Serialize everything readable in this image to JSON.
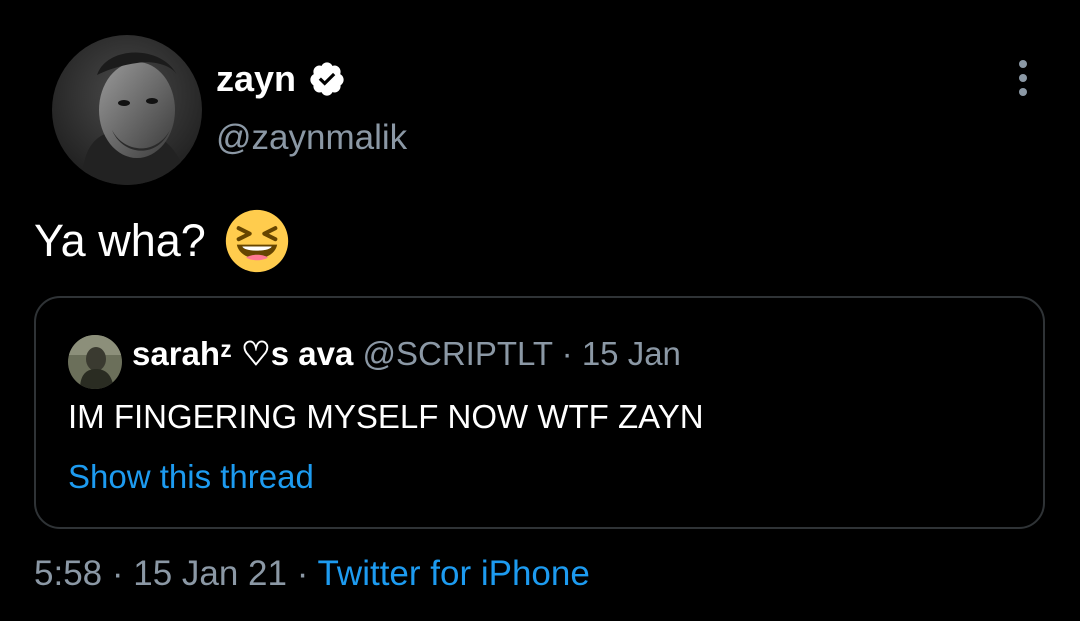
{
  "author": {
    "display_name": "zayn",
    "handle": "@zaynmalik",
    "verified_icon": "verified-badge-icon",
    "avatar_icon": "profile-photo"
  },
  "more_icon": "more-options-icon",
  "tweet": {
    "text": "Ya wha?",
    "emoji_icon": "laughing-emoji-icon"
  },
  "quoted_tweet": {
    "display_name": "sarahᶻ ♡s ava",
    "handle": "@SCRIPTLT",
    "separator": "·",
    "date": "15 Jan",
    "text": "IM FINGERING MYSELF NOW WTF ZAYN",
    "show_thread": "Show this thread"
  },
  "footer": {
    "time": "5:58",
    "sep1": "·",
    "date": "15 Jan 21",
    "sep2": "·",
    "source": "Twitter for iPhone"
  },
  "colors": {
    "background": "#000000",
    "text_primary": "#ffffff",
    "text_secondary": "#8b98a5",
    "accent": "#1d9bf0",
    "border": "#2f3336"
  }
}
